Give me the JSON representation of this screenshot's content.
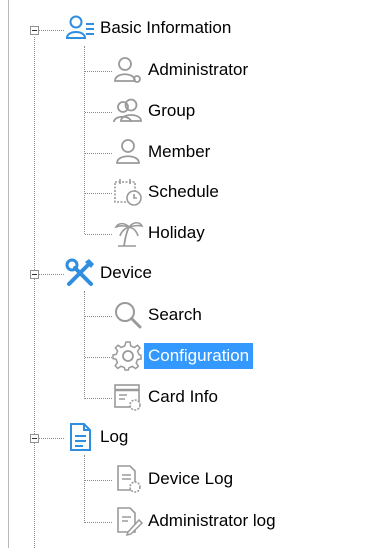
{
  "tree": {
    "groups": [
      {
        "label": "Basic Information",
        "icon": "users-list-icon",
        "expanded": true,
        "children": [
          {
            "label": "Administrator",
            "icon": "administrator-icon"
          },
          {
            "label": "Group",
            "icon": "group-icon"
          },
          {
            "label": "Member",
            "icon": "member-icon"
          },
          {
            "label": "Schedule",
            "icon": "schedule-icon"
          },
          {
            "label": "Holiday",
            "icon": "holiday-icon"
          }
        ]
      },
      {
        "label": "Device",
        "icon": "tools-icon",
        "expanded": true,
        "children": [
          {
            "label": "Search",
            "icon": "search-icon"
          },
          {
            "label": "Configuration",
            "icon": "gear-icon",
            "selected": true
          },
          {
            "label": "Card Info",
            "icon": "card-info-icon"
          }
        ]
      },
      {
        "label": "Log",
        "icon": "log-icon",
        "expanded": true,
        "children": [
          {
            "label": "Device Log",
            "icon": "device-log-icon"
          },
          {
            "label": "Administrator log",
            "icon": "administrator-log-icon"
          }
        ]
      }
    ],
    "colors": {
      "selection": "#3399ff",
      "icon_blue": "#2f8ee0",
      "icon_gray": "#9a9a9a"
    }
  }
}
